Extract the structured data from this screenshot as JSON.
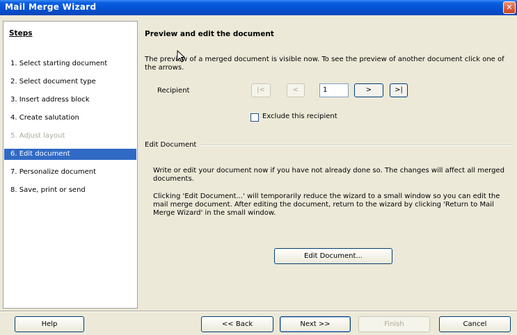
{
  "window": {
    "title": "Mail Merge Wizard",
    "close_glyph": "✕"
  },
  "steps": {
    "heading": "Steps",
    "items": [
      {
        "label": "1.  Select starting document",
        "state": "normal"
      },
      {
        "label": "2.  Select document type",
        "state": "normal"
      },
      {
        "label": "3.  Insert address block",
        "state": "normal"
      },
      {
        "label": "4.  Create salutation",
        "state": "normal"
      },
      {
        "label": "5.  Adjust layout",
        "state": "disabled"
      },
      {
        "label": "6.  Edit document",
        "state": "active"
      },
      {
        "label": "7.  Personalize document",
        "state": "normal"
      },
      {
        "label": "8.  Save, print or send",
        "state": "normal"
      }
    ]
  },
  "main": {
    "title": "Preview and edit the document",
    "intro": "The preview of a merged document is visible now. To see the preview of another document click one of the arrows.",
    "recipient_label": "Recipient",
    "nav": {
      "first": "|<",
      "prev": "<",
      "current": "1",
      "next": ">",
      "last": ">|"
    },
    "exclude_label": "Exclude this recipient",
    "edit_section_label": "Edit Document",
    "edit_para1": "Write or edit your document now if you have not already done so. The changes will affect all merged documents.",
    "edit_para2": "Clicking 'Edit Document...' will temporarily reduce the wizard to a small window so you can edit the mail merge document. After editing the document, return to the wizard by clicking 'Return to Mail Merge Wizard' in the small window.",
    "edit_button": "Edit Document..."
  },
  "buttons": {
    "help": "Help",
    "back": "<< Back",
    "next": "Next >>",
    "finish": "Finish",
    "cancel": "Cancel"
  },
  "colors": {
    "titlebar": "#0550d2",
    "selection": "#316ac5",
    "dialog_bg": "#ece9d8"
  }
}
